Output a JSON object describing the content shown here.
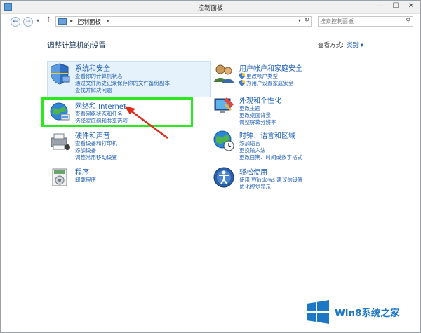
{
  "window": {
    "title": "控制面板",
    "controls": [
      "—",
      "☐",
      "✕"
    ]
  },
  "address": {
    "back_glyph": "←",
    "forward_glyph": "→",
    "dropdown_glyph": "▾",
    "up_glyph": "↑",
    "separator": "▸",
    "crumb": "控制面板",
    "refresh_glyph": "↻",
    "search_placeholder": "搜索控制面板",
    "search_glyph": "⚲"
  },
  "page": {
    "title": "调整计算机的设置",
    "view_label": "查看方式:",
    "view_value": "类别 ▾"
  },
  "categories": [
    {
      "title": "系统和安全",
      "links": [
        "查看你的计算机状态",
        "通过文件历史记录保存你的文件备份副本",
        "查找并解决问题"
      ],
      "icon": "system-security-icon"
    },
    {
      "title": "网络和 Internet",
      "links": [
        "查看网络状态和任务",
        "选择家庭组和共享选项"
      ],
      "icon": "network-internet-icon"
    },
    {
      "title": "硬件和声音",
      "links": [
        "查看设备和打印机",
        "添加设备",
        "调整常用移动设置"
      ],
      "icon": "hardware-sound-icon"
    },
    {
      "title": "程序",
      "links": [
        "卸载程序"
      ],
      "icon": "programs-icon"
    },
    {
      "title": "用户帐户和家庭安全",
      "links": [
        "更改帐户类型",
        "为用户设置家庭安全"
      ],
      "icon": "user-accounts-icon"
    },
    {
      "title": "外观和个性化",
      "links": [
        "更改主题",
        "更改桌面背景",
        "调整屏幕分辨率"
      ],
      "icon": "appearance-icon"
    },
    {
      "title": "时钟、语言和区域",
      "links": [
        "添加语言",
        "更换输入法",
        "更改日期、时间或数字格式"
      ],
      "icon": "clock-language-icon"
    },
    {
      "title": "轻松使用",
      "links": [
        "使用 Windows 建议的设置",
        "优化视觉显示"
      ],
      "icon": "ease-of-access-icon"
    }
  ],
  "watermark": {
    "brand": "Win8系统之家"
  },
  "colors": {
    "link": "#2b67b8",
    "title": "#1e5fb4",
    "highlight": "#2be81f",
    "arrow": "#e02a1a"
  }
}
